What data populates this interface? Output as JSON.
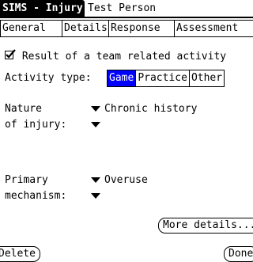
{
  "title_bar": {
    "app": "SIMS - Injury",
    "record": "Test Person"
  },
  "tabs": [
    {
      "label": "General",
      "selected": false
    },
    {
      "label": "Details",
      "selected": true
    },
    {
      "label": "Response",
      "selected": false
    },
    {
      "label": "Assessment",
      "selected": false
    }
  ],
  "team_activity": {
    "checked": true,
    "label": "Result of a team related activity"
  },
  "activity_type": {
    "label": "Activity type:",
    "options": [
      "Game",
      "Practice",
      "Other"
    ],
    "selected": "Game",
    "selected_color": "#0000ff"
  },
  "nature_of_injury": {
    "label_line1": "Nature",
    "label_line2": "of injury:",
    "value1": "Chronic history",
    "value2": ""
  },
  "primary_mechanism": {
    "label_line1": "Primary",
    "label_line2": "mechanism:",
    "value1": "Overuse",
    "value2": ""
  },
  "buttons": {
    "more_details": "More details...",
    "delete": "Delete",
    "done": "Done"
  }
}
